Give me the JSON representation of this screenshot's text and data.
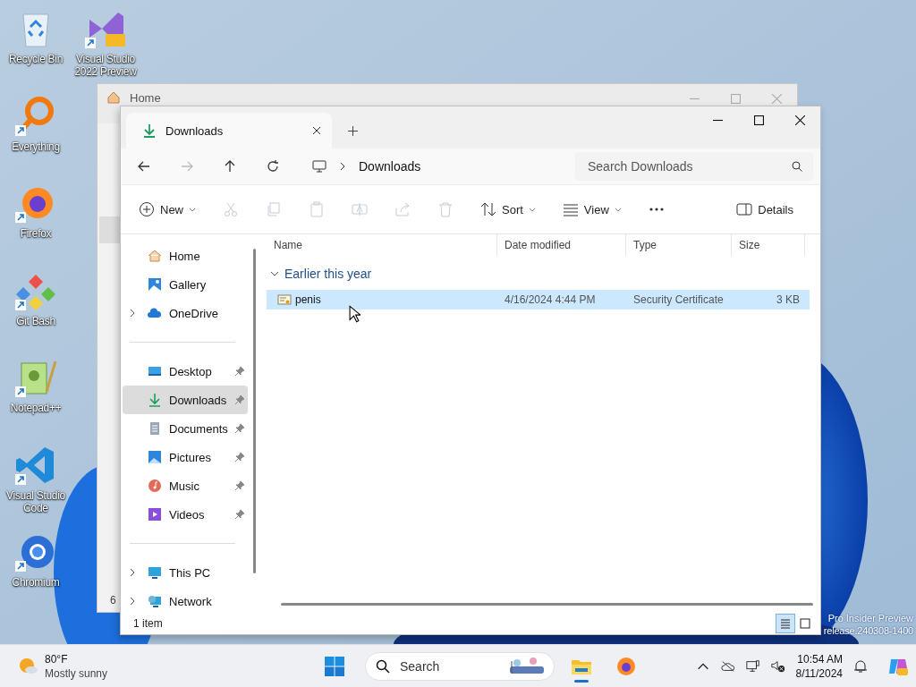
{
  "desktop_icons": [
    {
      "label": "Recycle Bin",
      "kind": "recycle",
      "shortcut": false
    },
    {
      "label": "Visual Studio 2022 Preview",
      "kind": "vs",
      "shortcut": true
    },
    {
      "label": "Everything",
      "kind": "everything",
      "shortcut": true
    },
    {
      "label": "Firefox",
      "kind": "firefox",
      "shortcut": true
    },
    {
      "label": "Git Bash",
      "kind": "git",
      "shortcut": true
    },
    {
      "label": "Notepad++",
      "kind": "notepad",
      "shortcut": true
    },
    {
      "label": "Visual Studio Code",
      "kind": "vscode",
      "shortcut": true
    },
    {
      "label": "Chromium",
      "kind": "chromium",
      "shortcut": true
    }
  ],
  "back_window": {
    "tab": "Home",
    "status": "6"
  },
  "window": {
    "tab": "Downloads",
    "address": "Downloads",
    "search": {
      "placeholder": "Search Downloads"
    },
    "toolbar": [
      {
        "kind": "new",
        "label": "New",
        "disabled": false
      },
      {
        "kind": "cut",
        "disabled": true
      },
      {
        "kind": "copy",
        "disabled": true
      },
      {
        "kind": "paste",
        "disabled": true
      },
      {
        "kind": "rename",
        "disabled": true
      },
      {
        "kind": "share",
        "disabled": true
      },
      {
        "kind": "delete",
        "disabled": true
      },
      {
        "kind": "sort",
        "label": "Sort",
        "disabled": false
      },
      {
        "kind": "view",
        "label": "View",
        "disabled": false
      },
      {
        "kind": "more",
        "disabled": false
      }
    ],
    "details": "Details",
    "nav": [
      [
        {
          "label": "Home",
          "kind": "home",
          "expandable": false,
          "pinned": false,
          "selected": false
        },
        {
          "label": "Gallery",
          "kind": "gallery",
          "expandable": false,
          "pinned": false,
          "selected": false
        },
        {
          "label": "OneDrive",
          "kind": "cloud",
          "expandable": true,
          "pinned": false,
          "selected": false
        }
      ],
      [
        {
          "label": "Desktop",
          "kind": "desktop",
          "expandable": false,
          "pinned": true,
          "selected": false
        },
        {
          "label": "Downloads",
          "kind": "download",
          "expandable": false,
          "pinned": true,
          "selected": true
        },
        {
          "label": "Documents",
          "kind": "documents",
          "expandable": false,
          "pinned": true,
          "selected": false
        },
        {
          "label": "Pictures",
          "kind": "pictures",
          "expandable": false,
          "pinned": true,
          "selected": false
        },
        {
          "label": "Music",
          "kind": "music",
          "expandable": false,
          "pinned": true,
          "selected": false
        },
        {
          "label": "Videos",
          "kind": "videos",
          "expandable": false,
          "pinned": true,
          "selected": false
        }
      ],
      [
        {
          "label": "This PC",
          "kind": "pc",
          "expandable": true,
          "pinned": false,
          "selected": false
        },
        {
          "label": "Network",
          "kind": "network",
          "expandable": true,
          "pinned": false,
          "selected": false
        }
      ]
    ],
    "columns": [
      "Name",
      "Date modified",
      "Type",
      "Size"
    ],
    "groups": [
      {
        "label": "Earlier this year",
        "expanded": true,
        "rows": [
          {
            "name": "penis",
            "date": "4/16/2024 4:44 PM",
            "type": "Security Certificate",
            "size": "3 KB",
            "selected": true
          }
        ]
      }
    ],
    "status": "1 item",
    "view_modes": [
      {
        "kind": "details",
        "selected": true
      },
      {
        "kind": "tiles",
        "selected": false
      }
    ]
  },
  "watermark": [
    "Pro Insider Preview",
    "release.240308-1400"
  ],
  "taskbar": {
    "weather": {
      "temperature": "80°F",
      "condition": "Mostly sunny"
    },
    "search": {
      "placeholder": "Search"
    },
    "apps": [
      {
        "kind": "explorer",
        "running": true
      },
      {
        "kind": "firefox",
        "running": false
      }
    ],
    "clock": {
      "time": "10:54 AM",
      "date": "8/11/2024"
    }
  }
}
